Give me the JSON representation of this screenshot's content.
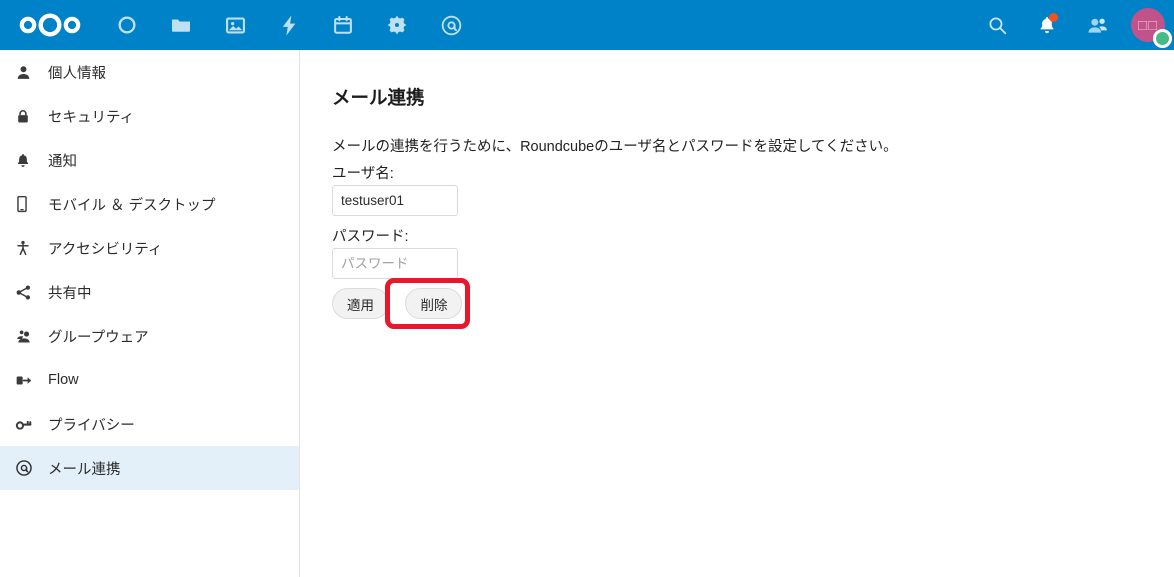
{
  "theme": {
    "header_blue": "#0082c9",
    "active_nav_blue": "#e4f0f9",
    "annotation_red": "#e8172a",
    "avatar_pink": "#c1538a",
    "status_green": "#46ba87",
    "badge_red": "#f4511e"
  },
  "header": {
    "logo_name": "nextcloud-logo",
    "app_icons": [
      {
        "name": "dashboard-icon",
        "label": "Dashboard"
      },
      {
        "name": "files-icon",
        "label": "Files"
      },
      {
        "name": "photos-icon",
        "label": "Photos"
      },
      {
        "name": "activity-icon",
        "label": "Activity"
      },
      {
        "name": "calendar-icon",
        "label": "Calendar"
      },
      {
        "name": "settings-gear-icon",
        "label": "Settings"
      },
      {
        "name": "mail-at-icon",
        "label": "Mail"
      }
    ],
    "right_icons": [
      {
        "name": "search-icon",
        "label": "Search"
      },
      {
        "name": "notifications-bell-icon",
        "label": "Notifications",
        "badge": true
      },
      {
        "name": "contacts-icon",
        "label": "Contacts"
      }
    ],
    "avatar": {
      "name": "user-avatar",
      "initials": "□□",
      "status": "online"
    }
  },
  "sidebar": {
    "items": [
      {
        "label": "個人情報",
        "icon": "person-icon",
        "active": false
      },
      {
        "label": "セキュリティ",
        "icon": "lock-icon",
        "active": false
      },
      {
        "label": "通知",
        "icon": "bell-icon",
        "active": false
      },
      {
        "label": "モバイル ＆ デスクトップ",
        "icon": "smartphone-icon",
        "active": false
      },
      {
        "label": "アクセシビリティ",
        "icon": "accessibility-icon",
        "active": false
      },
      {
        "label": "共有中",
        "icon": "share-icon",
        "active": false
      },
      {
        "label": "グループウェア",
        "icon": "group-icon",
        "active": false
      },
      {
        "label": "Flow",
        "icon": "flow-arrow-icon",
        "active": false
      },
      {
        "label": "プライバシー",
        "icon": "key-icon",
        "active": false
      },
      {
        "label": "メール連携",
        "icon": "at-icon",
        "active": true
      }
    ]
  },
  "main": {
    "title": "メール連携",
    "description": "メールの連携を行うために、Roundcubeのユーザ名とパスワードを設定してください。",
    "form": {
      "username_label": "ユーザ名:",
      "username_value": "testuser01",
      "username_placeholder": "",
      "password_label": "パスワード:",
      "password_value": "",
      "password_placeholder": "パスワード"
    },
    "buttons": {
      "apply_label": "適用",
      "delete_label": "削除"
    }
  },
  "annotation": {
    "name": "delete-button-highlight",
    "target": "削除",
    "color": "#e8172a"
  }
}
